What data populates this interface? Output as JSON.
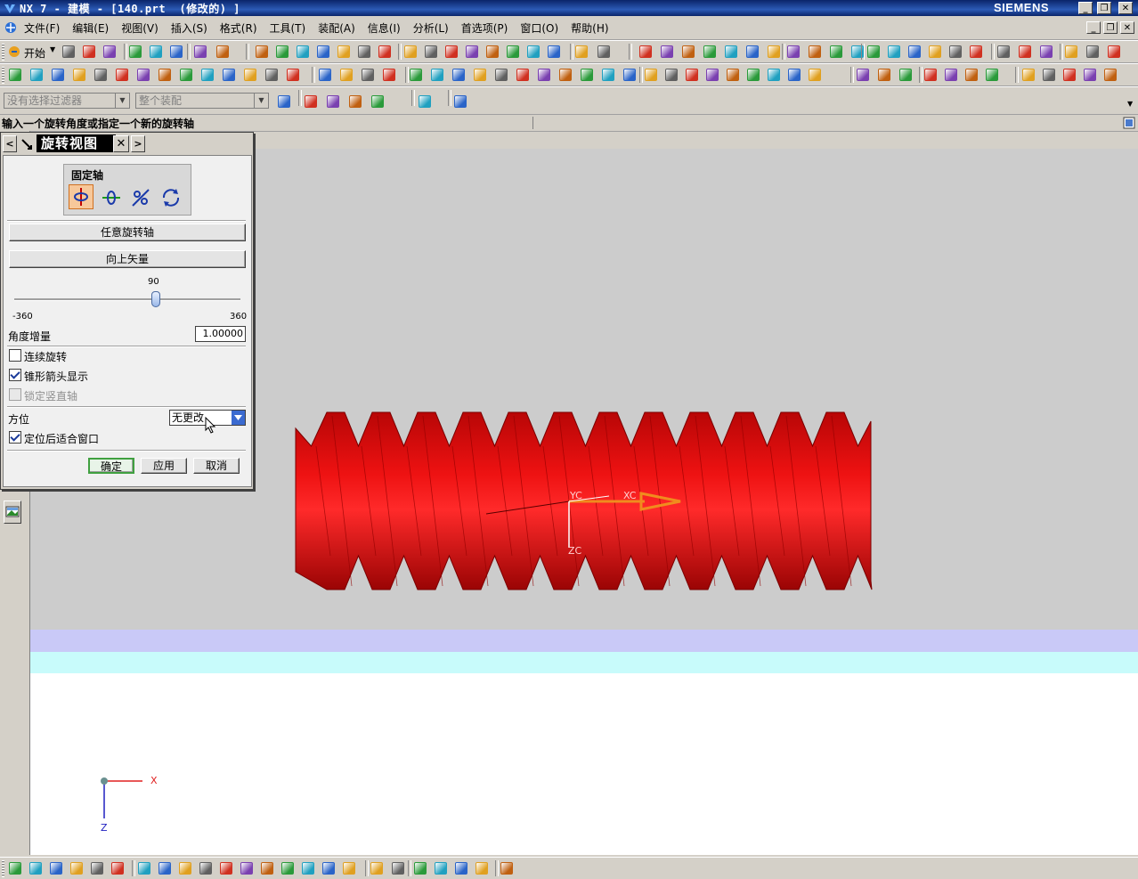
{
  "window": {
    "title": "NX 7 - 建模 - [140.prt  (修改的) ]",
    "brand": "SIEMENS",
    "minimize": "_",
    "restore": "❐",
    "close": "✕"
  },
  "menu": {
    "items": [
      "文件(F)",
      "编辑(E)",
      "视图(V)",
      "插入(S)",
      "格式(R)",
      "工具(T)",
      "装配(A)",
      "信息(I)",
      "分析(L)",
      "首选项(P)",
      "窗口(O)",
      "帮助(H)"
    ]
  },
  "toolbar": {
    "start_label": "开始",
    "filter_combo": "没有选择过滤器",
    "assembly_combo": "整个装配"
  },
  "cue_line": {
    "text": "输入一个旋转角度或指定一个新的旋转轴"
  },
  "dialog": {
    "title": "旋转视图",
    "fixed_axis_label": "固定轴",
    "arbitrary_axis_button": "任意旋转轴",
    "up_vector_button": "向上矢量",
    "slider": {
      "value": 90,
      "min": -360,
      "max": 360,
      "value_label": "90",
      "min_label": "-360",
      "max_label": "360"
    },
    "angle_increment_label": "角度增量",
    "angle_increment_value": "1.00000",
    "continuous_rotation_label": "连续旋转",
    "continuous_rotation_checked": false,
    "cone_arrow_label": "锥形箭头显示",
    "cone_arrow_checked": true,
    "lock_vertical_label": "锁定竖直轴",
    "lock_vertical_checked": false,
    "orientation_label": "方位",
    "orientation_value": "无更改",
    "fit_window_label": "定位后适合窗口",
    "fit_window_checked": true,
    "ok_button": "确定",
    "apply_button": "应用",
    "cancel_button": "取消"
  },
  "viewport": {
    "triad_xc": "XC",
    "triad_yc": "YC",
    "triad_zc": "ZC",
    "corner_x": "X",
    "corner_z": "Z",
    "part_color": "#e81010",
    "axis_arrow_color": "#f08c1e"
  }
}
